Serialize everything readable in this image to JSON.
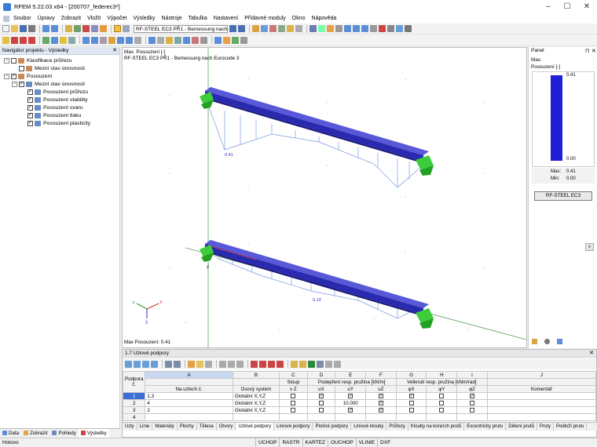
{
  "window": {
    "title": "RFEM 5.22.03 x64 - [200707_federec3*]"
  },
  "menu": [
    "Soubor",
    "Úpravy",
    "Zobrazit",
    "Vložit",
    "Výpočet",
    "Výsledky",
    "Nástroje",
    "Tabulka",
    "Nastavení",
    "Přídavné moduly",
    "Okno",
    "Nápověda"
  ],
  "toolbar": {
    "case_combo": "RF-STEEL EC3 PŘ1 - Bemessung nach E"
  },
  "navigator": {
    "title": "Navigátor projektu - Výsledky",
    "items": [
      {
        "label": "Klasifikace průřezu",
        "level": 0,
        "checked": false
      },
      {
        "label": "Mezní stav únosnosti",
        "level": 1,
        "checked": false
      },
      {
        "label": "Posouzení",
        "level": 0,
        "checked": true
      },
      {
        "label": "Mezní stav únosnosti",
        "level": 1,
        "checked": true
      },
      {
        "label": "Posouzení průřezu",
        "level": 2,
        "checked": true
      },
      {
        "label": "Posouzení stability",
        "level": 2,
        "checked": true
      },
      {
        "label": "Posouzení svaru",
        "level": 2,
        "checked": true
      },
      {
        "label": "Posouzení tlaku",
        "level": 2,
        "checked": true
      },
      {
        "label": "Posouzení plasticity",
        "level": 2,
        "checked": true
      }
    ],
    "tabs": [
      "Data",
      "Zobrazit",
      "Pohledy",
      "Výsledky"
    ]
  },
  "viewport": {
    "header_line1": "Max. Posouzení [-]",
    "header_line2": "RF-STEEL EC3 PŘ1 - Bemessung nach Eurocode 3",
    "footer": "Max Posouzení: 0.41",
    "label_top": "0.41",
    "label_bottom": "0.13",
    "axis_x": "X",
    "axis_y": "Y",
    "axis_z": "Z",
    "beam_z": "Z"
  },
  "panel": {
    "title": "Panel",
    "line1": "Max.",
    "line2": "Posouzení [-]",
    "scale_max": "0.41",
    "scale_min": "0.00",
    "fill_fraction": 1.0,
    "max_label": "Max:",
    "max_value": "0.41",
    "min_label": "Min:",
    "min_value": "0.00",
    "button": "RF-STEEL EC3",
    "bar_color": "#1f1fd8"
  },
  "table": {
    "title": "1.7 Uzlové podpory",
    "col_letters": [
      "A",
      "B",
      "C",
      "D",
      "E",
      "F",
      "G",
      "H",
      "I",
      "J"
    ],
    "h1": {
      "podpora": "Podpora",
      "nodes": "",
      "axis": "",
      "sloup": "Sloup",
      "podpereni": "Podepření resp. pružina [kN/m]",
      "vetknuti": "Vetknutí resp. pružina [kNm/rad]",
      "komentar": ""
    },
    "h2": {
      "podpora": "č.",
      "nodes": "Na uzlech č.",
      "axis": "Osový systém",
      "sloup": "v Z",
      "ux": "uX",
      "uy": "uY",
      "uz": "uZ",
      "fx": "φX",
      "fy": "φY",
      "fz": "φZ",
      "komentar": "Komentář"
    },
    "rows": [
      {
        "no": "1",
        "nodes": "1,3",
        "axis": "Globální X,Y,Z",
        "sloup": false,
        "ux": true,
        "uy": true,
        "uz": true,
        "fx": true,
        "fy": false,
        "fz": true,
        "comment": ""
      },
      {
        "no": "2",
        "nodes": "4",
        "axis": "Globální X,Y,Z",
        "sloup": false,
        "ux": false,
        "uy": "10.000",
        "uz": true,
        "fx": false,
        "fy": false,
        "fz": false,
        "comment": ""
      },
      {
        "no": "3",
        "nodes": "2",
        "axis": "Globální X,Y,Z",
        "sloup": false,
        "ux": false,
        "uy": true,
        "uz": true,
        "fx": false,
        "fy": false,
        "fz": false,
        "comment": ""
      },
      {
        "no": "4",
        "nodes": "",
        "axis": "",
        "sloup": null,
        "ux": null,
        "uy": null,
        "uz": null,
        "fx": null,
        "fy": null,
        "fz": null,
        "comment": ""
      }
    ],
    "tabs": [
      "Uzly",
      "Linie",
      "Materiály",
      "Plochy",
      "Tělesa",
      "Otvory",
      "Uzlové podpory",
      "Liniové podpory",
      "Plošné podpory",
      "Liniové klouby",
      "Průřezy",
      "Klouby na koncích prutů",
      "Excentricity prutu",
      "Dělení prutů",
      "Pruty",
      "Podloží prutu"
    ],
    "active_tab": "Uzlové podpory"
  },
  "status": {
    "left": "Hotovo",
    "items": [
      "UCHOP",
      "RASTR",
      "KARTEZ",
      "OUCHOP",
      "VLINIE",
      "DXF"
    ]
  }
}
